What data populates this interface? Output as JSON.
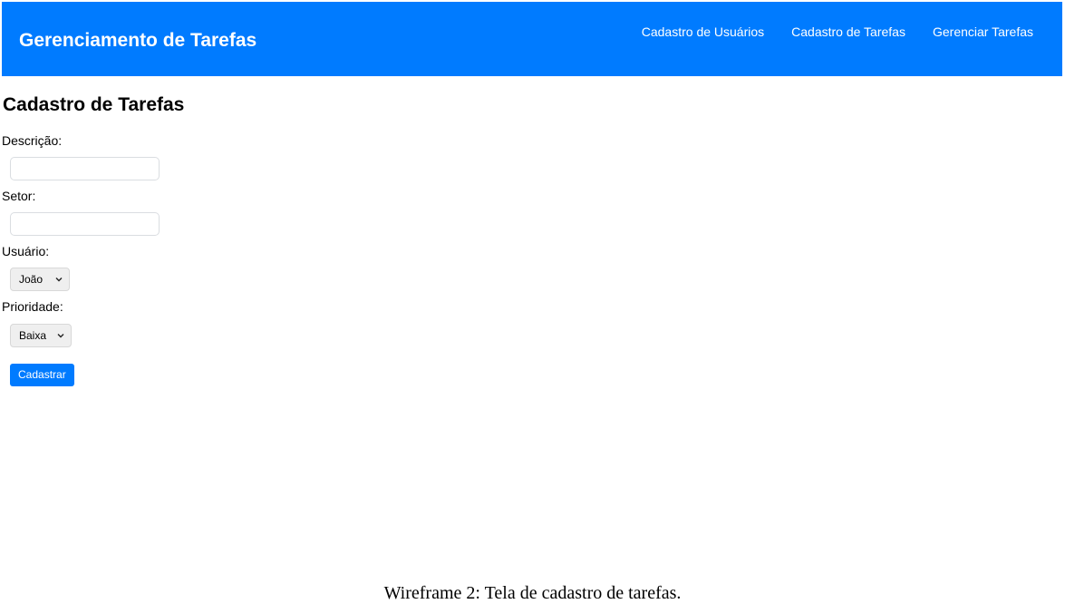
{
  "navbar": {
    "brand": "Gerenciamento de Tarefas",
    "links": [
      {
        "label": "Cadastro de Usuários"
      },
      {
        "label": "Cadastro de Tarefas"
      },
      {
        "label": "Gerenciar Tarefas"
      }
    ],
    "background_color": "#007bff"
  },
  "page": {
    "title": "Cadastro de Tarefas"
  },
  "form": {
    "descricao_label": "Descrição:",
    "descricao_value": "",
    "setor_label": "Setor:",
    "setor_value": "",
    "usuario_label": "Usuário:",
    "usuario_selected": "João",
    "prioridade_label": "Prioridade:",
    "prioridade_selected": "Baixa",
    "submit_label": "Cadastrar"
  },
  "caption": "Wireframe 2: Tela de cadastro de tarefas."
}
